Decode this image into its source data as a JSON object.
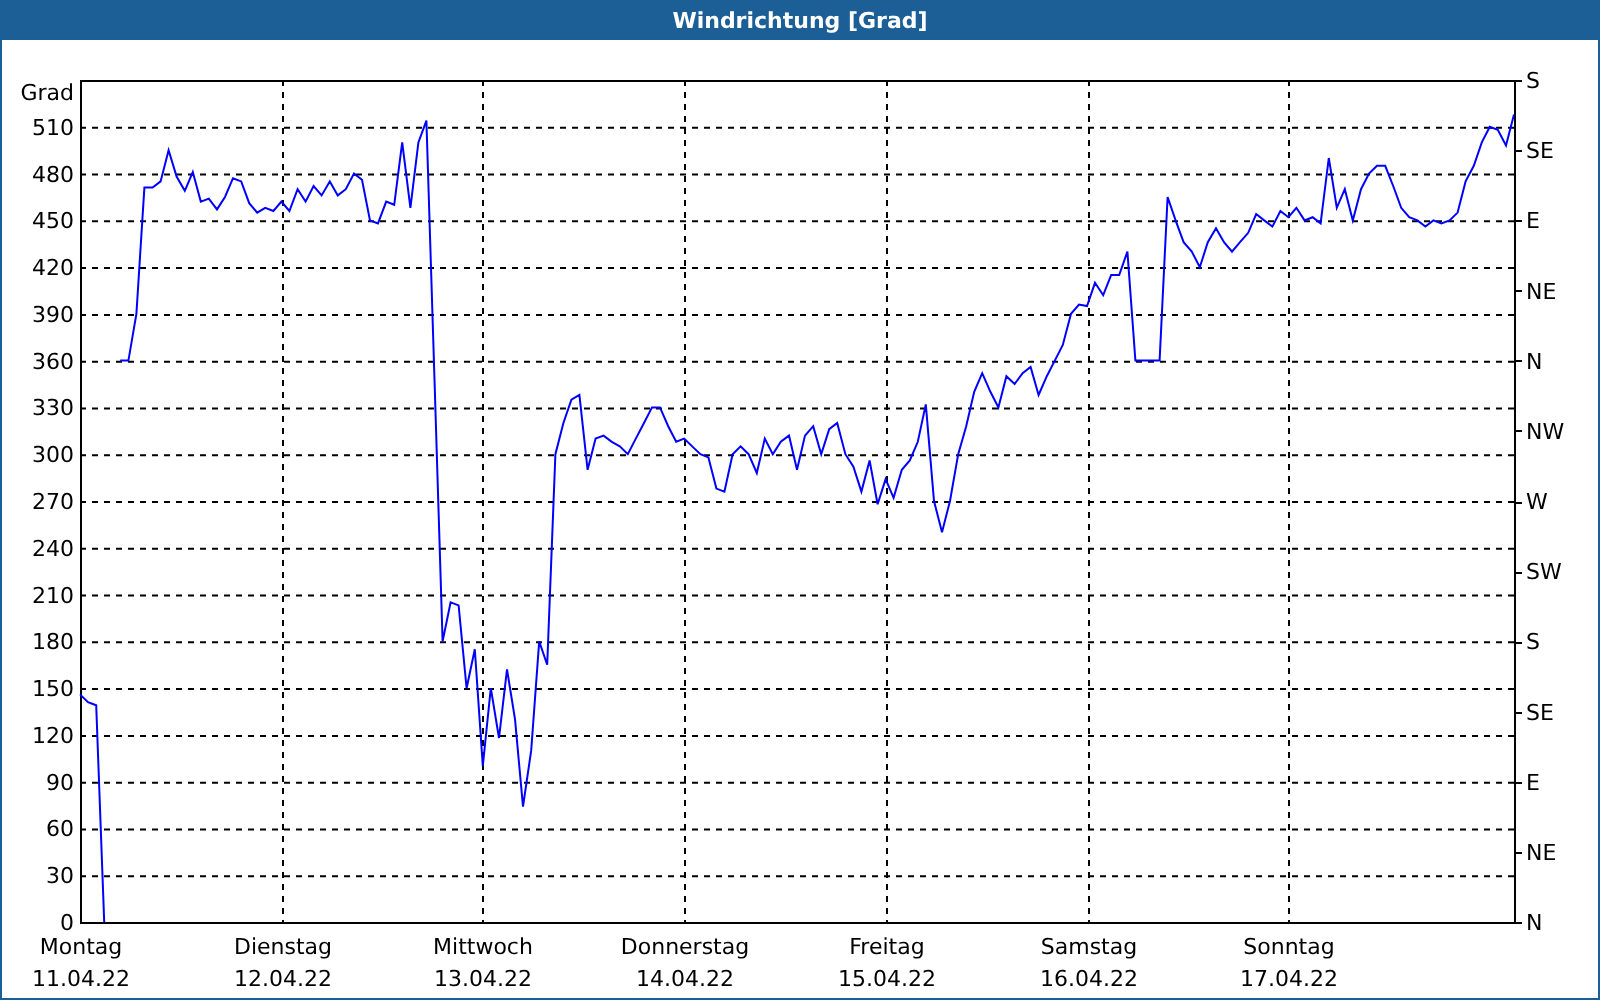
{
  "window": {
    "title": "Windrichtung [Grad]"
  },
  "chart": {
    "chart_data": {
      "type": "line",
      "grid": true,
      "ylabel": "Grad",
      "ylim": [
        0,
        540
      ],
      "yticks": [
        0,
        30,
        60,
        90,
        120,
        150,
        180,
        210,
        240,
        270,
        300,
        330,
        360,
        390,
        420,
        450,
        480,
        510
      ],
      "categories": [
        "Montag 11.04.22",
        null,
        null,
        null,
        null,
        null,
        null,
        null,
        null,
        null,
        null,
        null,
        null,
        null,
        null,
        null,
        null,
        null,
        null,
        null,
        null,
        null,
        null,
        null,
        null,
        "Dienstag 12.04.22",
        null,
        null,
        null,
        null,
        null,
        null,
        null,
        null,
        null,
        null,
        null,
        null,
        null,
        null,
        null,
        null,
        null,
        null,
        null,
        null,
        null,
        null,
        null,
        null,
        "Mittwoch 13.04.22",
        null,
        null,
        null,
        null,
        null,
        null,
        null,
        null,
        null,
        null,
        null,
        null,
        null,
        null,
        null,
        null,
        null,
        null,
        null,
        null,
        null,
        null,
        null,
        null,
        "Donnerstag 14.04.22",
        null,
        null,
        null,
        null,
        null,
        null,
        null,
        null,
        null,
        null,
        null,
        null,
        null,
        null,
        null,
        null,
        null,
        null,
        null,
        null,
        null,
        null,
        null,
        null,
        "Freitag 15.04.22",
        null,
        null,
        null,
        null,
        null,
        null,
        null,
        null,
        null,
        null,
        null,
        null,
        null,
        null,
        null,
        null,
        null,
        null,
        null,
        null,
        null,
        null,
        null,
        null,
        "Samstag 16.04.22",
        null,
        null,
        null,
        null,
        null,
        null,
        null,
        null,
        null,
        null,
        null,
        null,
        null,
        null,
        null,
        null,
        null,
        null,
        null,
        null,
        null,
        null,
        null,
        null,
        "Sonntag 17.04.22",
        null,
        null,
        null,
        null,
        null,
        null,
        null,
        null,
        null,
        null,
        null,
        null,
        null,
        null,
        null,
        null,
        null,
        null,
        null,
        null,
        null,
        null,
        null,
        null,
        null,
        null,
        null,
        null
      ],
      "series": [
        {
          "color": "#0000ff",
          "values": [
            146,
            141,
            139,
            0,
            null,
            360,
            360,
            390,
            471,
            471,
            475,
            495,
            478,
            469,
            481,
            462,
            464,
            457,
            465,
            477,
            475,
            461,
            455,
            458,
            456,
            462,
            456,
            470,
            462,
            472,
            466,
            475,
            466,
            470,
            480,
            476,
            450,
            448,
            462,
            460,
            500,
            458,
            500,
            514,
            350,
            180,
            205,
            203,
            150,
            175,
            100,
            150,
            118,
            162,
            130,
            74,
            110,
            180,
            165,
            300,
            320,
            335,
            338,
            290,
            310,
            312,
            308,
            305,
            300,
            310,
            320,
            330,
            330,
            318,
            308,
            310,
            305,
            300,
            298,
            278,
            276,
            300,
            305,
            300,
            288,
            310,
            300,
            308,
            312,
            290,
            312,
            318,
            300,
            316,
            320,
            300,
            292,
            276,
            296,
            268,
            284,
            272,
            290,
            296,
            308,
            332,
            270,
            250,
            270,
            300,
            318,
            340,
            352,
            340,
            330,
            350,
            345,
            352,
            356,
            338,
            350,
            360,
            370,
            390,
            396,
            395,
            410,
            402,
            415,
            415,
            430,
            360,
            360,
            360,
            360,
            465,
            450,
            436,
            430,
            420,
            436,
            445,
            436,
            430,
            436,
            442,
            454,
            450,
            446,
            456,
            452,
            458,
            450,
            452,
            448,
            490,
            458,
            470,
            450,
            470,
            480,
            485,
            485,
            472,
            458,
            452,
            450,
            446,
            450,
            448,
            450,
            455,
            475,
            485,
            500,
            510,
            508,
            498,
            518
          ]
        }
      ]
    },
    "compass_axis": {
      "labels": [
        "S",
        "SE",
        "E",
        "NE",
        "N",
        "NW",
        "W",
        "SW",
        "S",
        "SE",
        "E",
        "NE",
        "N"
      ]
    }
  }
}
